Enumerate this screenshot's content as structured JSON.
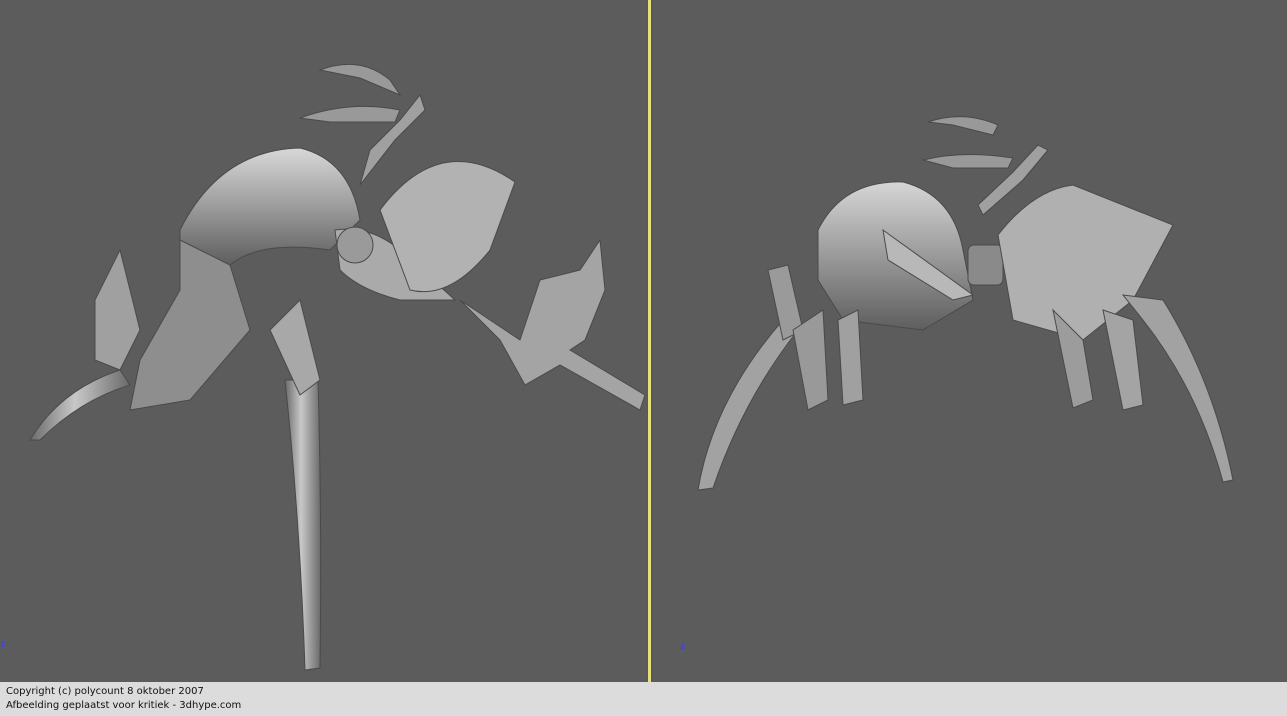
{
  "viewports": {
    "left": {
      "axis_label": "z"
    },
    "right": {
      "axis_label": "z"
    }
  },
  "footer": {
    "line1": "Copyright (c) polycount 8 oktober 2007",
    "line2": "Afbeelding geplaatst voor kritiek - 3dhype.com"
  },
  "colors": {
    "viewport_bg": "#5c5c5c",
    "active_border": "#e6e27a",
    "footer_bg": "#dcdcdc",
    "model_gray": "#9a9a9a"
  }
}
